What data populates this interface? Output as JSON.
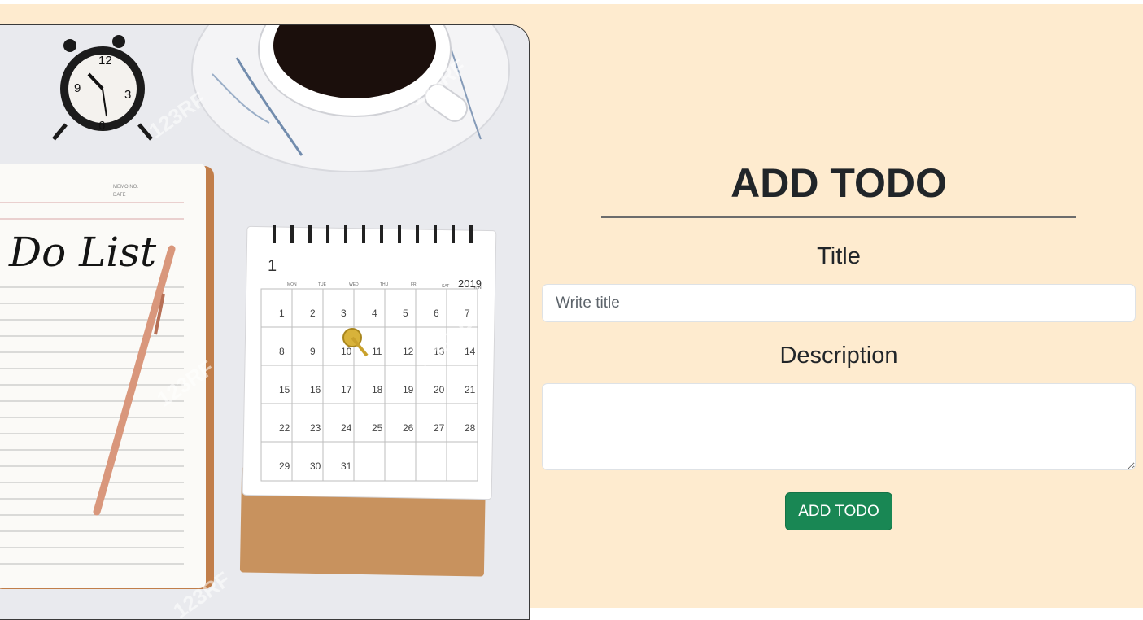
{
  "form": {
    "heading": "ADD TODO",
    "title_label": "Title",
    "title_placeholder": "Write title",
    "title_value": "",
    "description_label": "Description",
    "description_value": "",
    "submit_label": "ADD TODO"
  },
  "hero_image": {
    "notebook_heading": "Do List",
    "memo_label": "MEMO NO.",
    "date_label": "DATE",
    "calendar_month": "1",
    "calendar_year": "2019",
    "calendar_weekdays": [
      "MON",
      "TUE",
      "WED",
      "THU",
      "FRI",
      "SAT",
      "SUN"
    ],
    "calendar_weeks": [
      [
        "",
        "1",
        "2",
        "3",
        "4",
        "5",
        "6",
        "7"
      ],
      [
        "",
        "8",
        "9",
        "10",
        "11",
        "12",
        "13",
        "14"
      ],
      [
        "",
        "15",
        "16",
        "17",
        "18",
        "19",
        "20",
        "21"
      ],
      [
        "",
        "22",
        "23",
        "24",
        "25",
        "26",
        "27",
        "28"
      ],
      [
        "",
        "29",
        "30",
        "31",
        "",
        "",
        "",
        ""
      ]
    ],
    "clock_numbers": [
      "12",
      "3",
      "6",
      "9"
    ],
    "watermark": "123RF"
  },
  "colors": {
    "page_background": "#feebcf",
    "button_green": "#198754",
    "text_dark": "#212529"
  }
}
